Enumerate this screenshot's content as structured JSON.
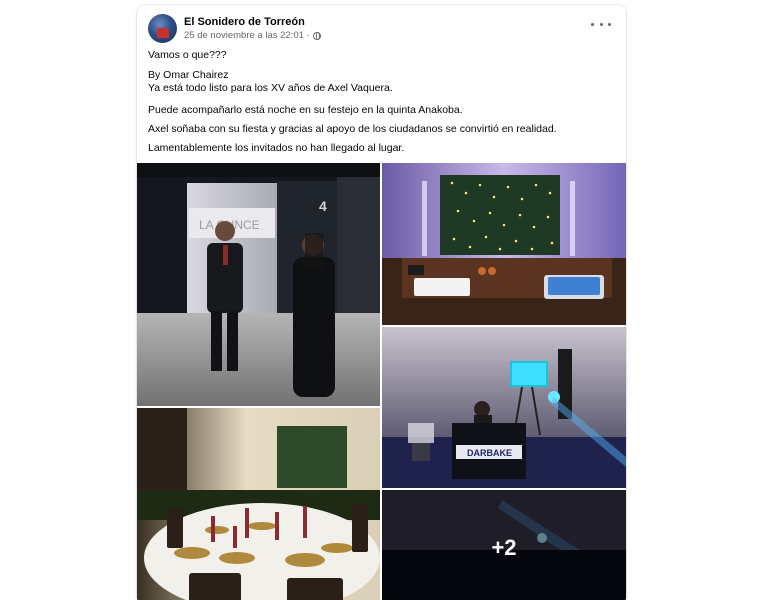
{
  "post": {
    "page_name": "El Sonidero de Torreón",
    "timestamp": "25 de noviembre a las 22:01 ·",
    "more_count": "+2",
    "lines": [
      "Vamos o que???",
      "By Omar Chairez",
      "Ya está todo listo para los XV años de Axel Vaquera.",
      "Puede acompañarlo está noche en su festejo en la quinta Anakoba.",
      "Axel soñaba con su fiesta y gracias al apoyo de los ciudadanos se convirtió en realidad.",
      "Lamentablemente los invitados no han llegado al lugar."
    ]
  },
  "photo_texts": {
    "venue_sign": "LA OUNCE",
    "building_number": "4",
    "dj_booth_label": "DARBAKE"
  },
  "icons": {
    "privacy": "globe-icon",
    "menu": "more-options-icon"
  },
  "colors": {
    "text_primary": "#050505",
    "text_secondary": "#65676b",
    "background": "#ffffff"
  }
}
